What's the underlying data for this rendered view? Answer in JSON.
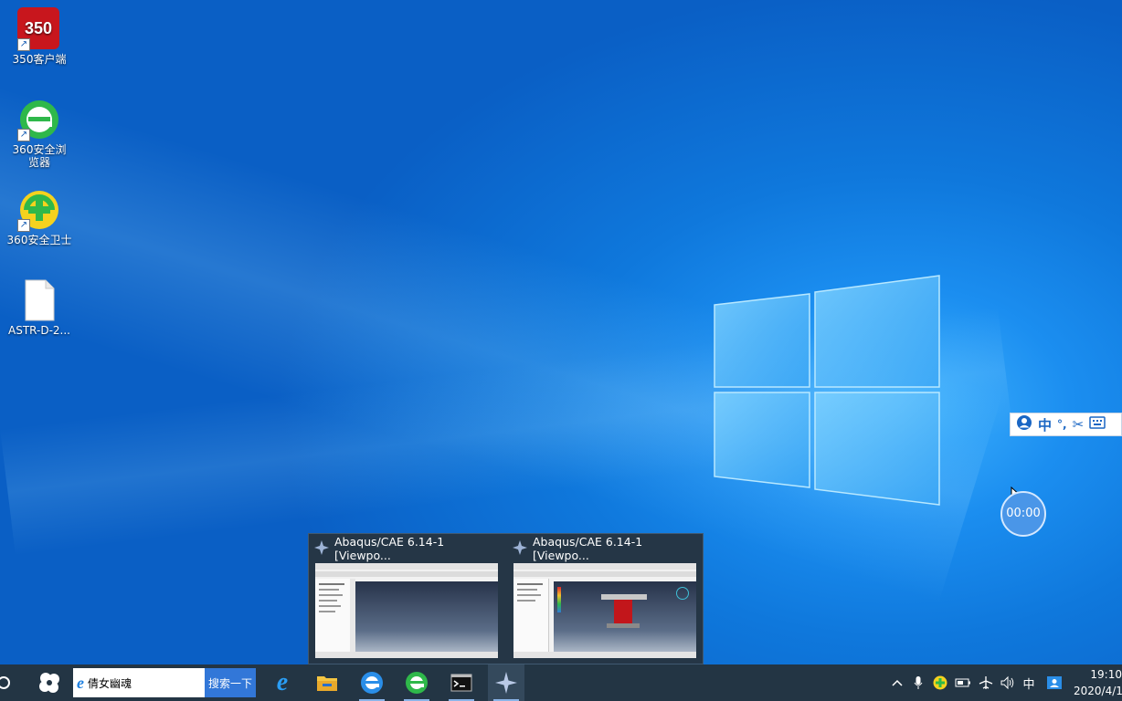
{
  "desktop_icons": [
    {
      "label": "350客户端",
      "icon": "350-client-icon",
      "text": "350"
    },
    {
      "label": "360安全浏览器",
      "icon": "360-browser-icon"
    },
    {
      "label": "360安全卫士",
      "icon": "360-security-icon"
    },
    {
      "label": "ASTR-D-2...",
      "icon": "file-icon"
    }
  ],
  "ime_toolbar": {
    "mode": "中",
    "punct": "°,"
  },
  "timer": {
    "value": "00:00"
  },
  "thumbnails": [
    {
      "title": "Abaqus/CAE 6.14-1 [Viewpo..."
    },
    {
      "title": "Abaqus/CAE 6.14-1 [Viewpo..."
    }
  ],
  "taskbar": {
    "search_query": "倩女幽魂",
    "search_button": "搜索一下",
    "apps": [
      "ie-icon",
      "file-explorer-icon",
      "360-browser-icon",
      "360-browser-alt-icon",
      "terminal-icon",
      "abaqus-icon"
    ],
    "tray": {
      "ime": "中",
      "time": "19:10",
      "date": "2020/4/1"
    }
  },
  "colors": {
    "taskbar": "#233544",
    "desktop": "#0f78dc",
    "accent": "#3277d8"
  }
}
